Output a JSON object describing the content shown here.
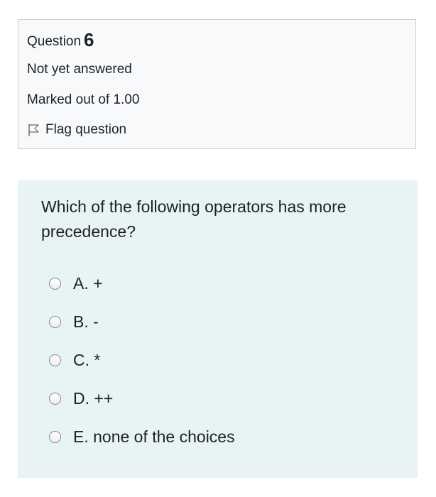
{
  "question_info": {
    "label": "Question",
    "number": "6",
    "state": "Not yet answered",
    "grade": "Marked out of 1.00",
    "flag_label": "Flag question",
    "flag_icon": "flag-icon"
  },
  "question": {
    "text": "Which of the following operators has more precedence?",
    "options": [
      {
        "label": "A. +"
      },
      {
        "label": "B. -"
      },
      {
        "label": "C. *"
      },
      {
        "label": "D. ++"
      },
      {
        "label": "E. none of the choices"
      }
    ],
    "selected": null
  },
  "colors": {
    "info_bg": "#f8f9fa",
    "info_border": "#cfcfcf",
    "content_bg": "#e7f3f5",
    "text": "#1d2125"
  }
}
